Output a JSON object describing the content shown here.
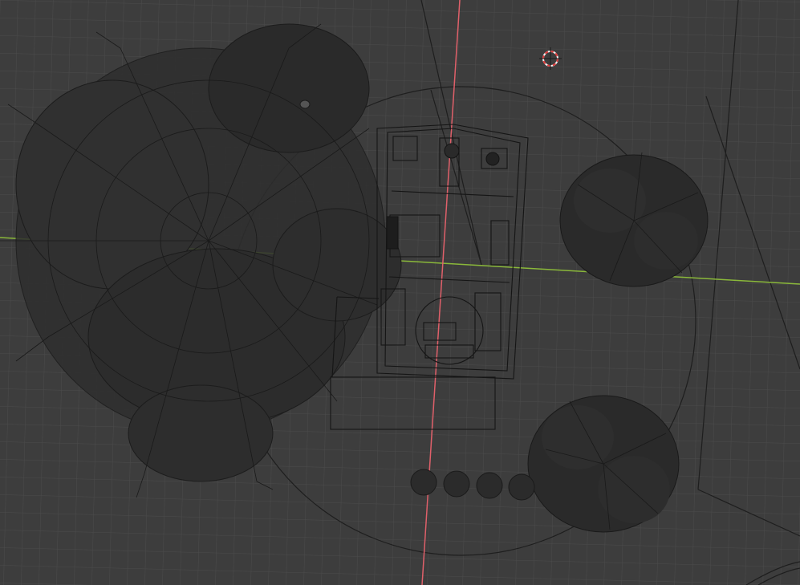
{
  "viewport": {
    "mode": "top-orthographic-wireframe",
    "colors": {
      "background": "#3d3d3d",
      "grid": "#4a4a4a",
      "x_axis": "#e0606a",
      "y_axis": "#8ab83a",
      "wire": "#1a1a1a",
      "foliage": "#2a2a2a",
      "cursor_red": "#e03a3a",
      "cursor_white": "#f0f0f0"
    },
    "objects": [
      {
        "name": "large-tree",
        "type": "tree"
      },
      {
        "name": "tree-right-upper",
        "type": "tree"
      },
      {
        "name": "tree-right-lower",
        "type": "tree"
      },
      {
        "name": "shrub-row",
        "type": "shrubs",
        "count": 4
      },
      {
        "name": "cabin",
        "type": "building"
      },
      {
        "name": "camera-frustum",
        "type": "camera"
      },
      {
        "name": "light-radius",
        "type": "light"
      }
    ]
  }
}
